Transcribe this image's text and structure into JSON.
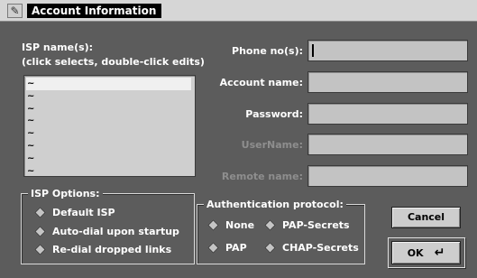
{
  "window": {
    "title": "Account Information",
    "icon": "pen-icon"
  },
  "isp": {
    "label_line1": "ISP name(s):",
    "label_line2": "(click selects, double-click edits)",
    "items": [
      "~",
      "~",
      "~",
      "~",
      "~",
      "~",
      "~",
      "~"
    ]
  },
  "fields": {
    "phone": {
      "label": "Phone no(s):",
      "value": ""
    },
    "account": {
      "label": "Account name:",
      "value": ""
    },
    "password": {
      "label": "Password:",
      "value": ""
    },
    "username": {
      "label": "UserName:",
      "value": ""
    },
    "remote": {
      "label": "Remote name:",
      "value": ""
    }
  },
  "isp_options": {
    "title": "ISP Options:",
    "items": [
      "Default ISP",
      "Auto-dial upon startup",
      "Re-dial dropped links"
    ]
  },
  "auth": {
    "title": "Authentication protocol:",
    "options": [
      "None",
      "PAP-Secrets",
      "PAP",
      "CHAP-Secrets"
    ]
  },
  "buttons": {
    "cancel": "Cancel",
    "ok": "OK"
  },
  "colors": {
    "background": "#5c5c5c",
    "field": "#c3c3c3",
    "title_bar": "#d6d6d6",
    "disabled_text": "#8e8e8e"
  }
}
